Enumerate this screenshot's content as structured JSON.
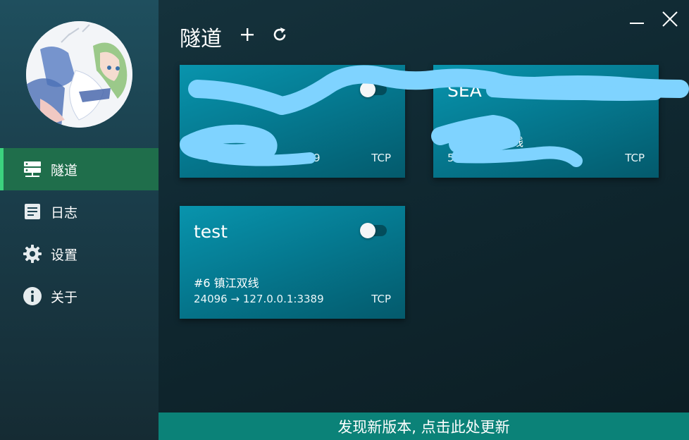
{
  "sidebar": {
    "avatar_icon": "anime-avatar",
    "items": [
      {
        "label": "隧道",
        "icon": "server-icon",
        "active": true
      },
      {
        "label": "日志",
        "icon": "document-icon",
        "active": false
      },
      {
        "label": "设置",
        "icon": "gear-icon",
        "active": false
      },
      {
        "label": "关于",
        "icon": "info-icon",
        "active": false
      }
    ]
  },
  "header": {
    "title": "隧道",
    "add_label": "+",
    "refresh_icon": "refresh-icon"
  },
  "window": {
    "minimize_icon": "minimize-icon",
    "close_icon": "close-icon"
  },
  "tunnels": [
    {
      "name": "",
      "node": "",
      "mapping": "9",
      "protocol": "TCP",
      "enabled": false
    },
    {
      "name": "SEA",
      "node": "线",
      "mapping": "5",
      "protocol": "TCP",
      "enabled": false
    },
    {
      "name": "test",
      "node": "#6 镇江双线",
      "mapping": "24096 → 127.0.0.1:3389",
      "protocol": "TCP",
      "enabled": false
    }
  ],
  "update_bar": {
    "text": "发现新版本, 点击此处更新"
  },
  "colors": {
    "accent": "#3cd37e",
    "nav_active": "#1f6e4b",
    "card": "#057a91",
    "update_bar": "#0b8278",
    "scribble": "#7fd3ff"
  }
}
